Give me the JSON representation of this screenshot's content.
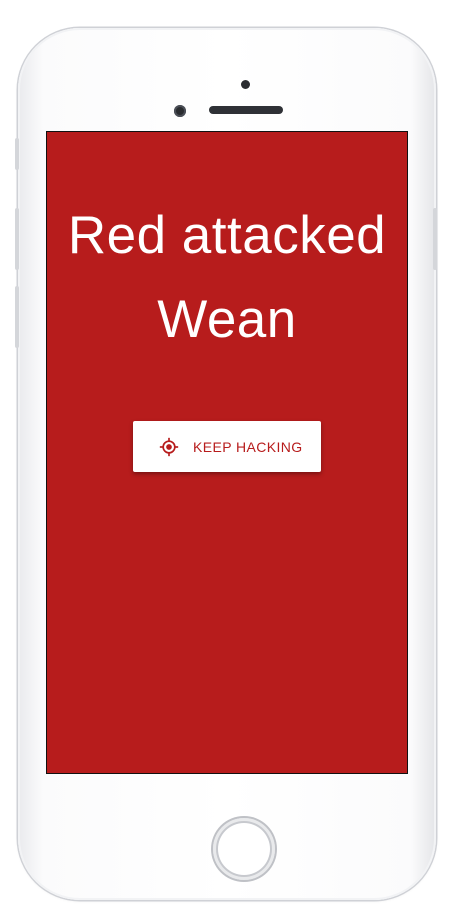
{
  "screen": {
    "title_line1": "Red attacked",
    "title_line2": "Wean",
    "background_color": "#b71c1c"
  },
  "action_button": {
    "label": "KEEP HACKING",
    "icon": "crosshair-icon",
    "text_color": "#b71c1c"
  }
}
